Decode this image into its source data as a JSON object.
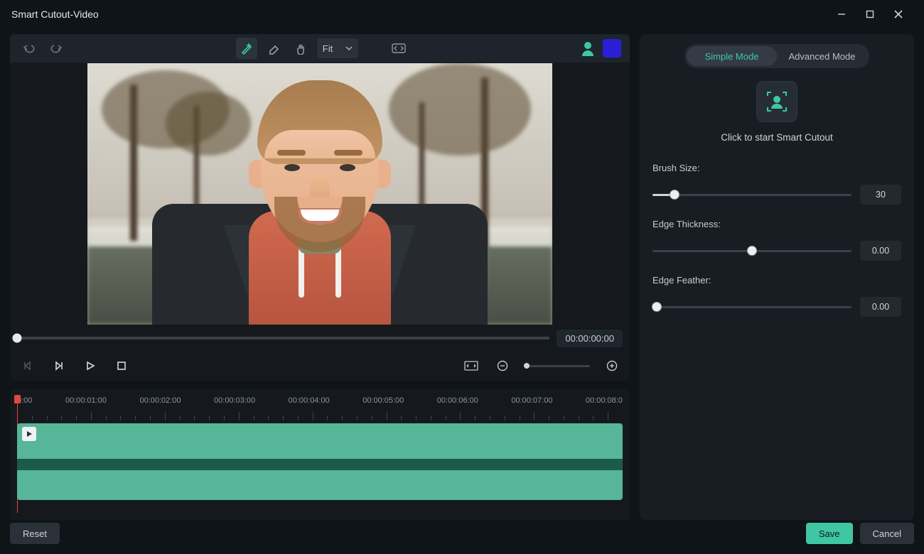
{
  "window": {
    "title": "Smart Cutout-Video"
  },
  "toolbar": {
    "zoom_label": "Fit",
    "silhouette_color": "#3fc79f",
    "swatch_color": "#2b1fd6"
  },
  "timecode": "00:00:00:00",
  "ruler_labels": [
    "0:00",
    "00:00:01:00",
    "00:00:02:00",
    "00:00:03:00",
    "00:00:04:00",
    "00:00:05:00",
    "00:00:06:00",
    "00:00:07:00",
    "00:00:08:0"
  ],
  "modes": {
    "simple": "Simple Mode",
    "advanced": "Advanced Mode"
  },
  "start_label": "Click to start Smart Cutout",
  "params": {
    "brush_size": {
      "label": "Brush Size:",
      "value": "30",
      "pct": 11
    },
    "edge_thickness": {
      "label": "Edge Thickness:",
      "value": "0.00",
      "pct": 50
    },
    "edge_feather": {
      "label": "Edge Feather:",
      "value": "0.00",
      "pct": 2
    }
  },
  "footer": {
    "reset": "Reset",
    "save": "Save",
    "cancel": "Cancel"
  },
  "accent": "#3fc7a3"
}
